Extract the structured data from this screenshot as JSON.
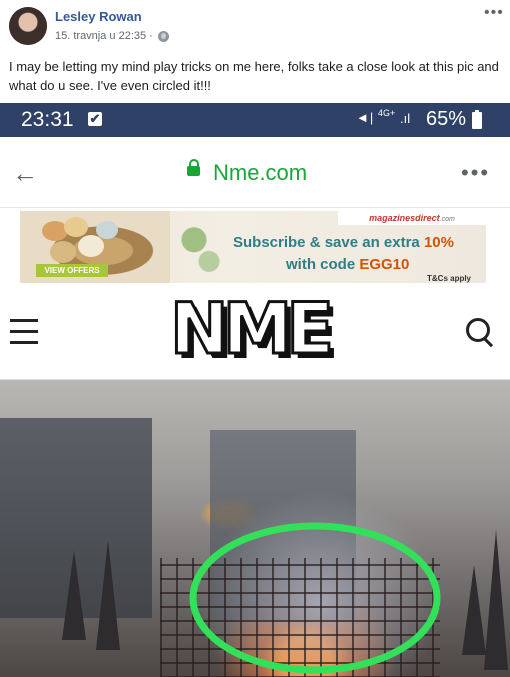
{
  "post": {
    "author": "Lesley Rowan",
    "timestamp": "15. travnja u 22:35 ·",
    "privacy_icon": "globe-icon",
    "more_label": "•••",
    "caption": "I may be letting my mind play tricks on me here, folks take a close look at this pic and what do u see. I've even circled it!!!"
  },
  "phone": {
    "status": {
      "time": "23:31",
      "notif_mark": "✔",
      "network": "4G+",
      "signal_glyph": "⁴ᴳ⁺",
      "battery": "65%"
    },
    "browser": {
      "back_glyph": "←",
      "url": "Nme.com",
      "menu_glyph": "•••"
    },
    "ad": {
      "brand": "magazinesdirect",
      "brand_suffix": ".com",
      "cta": "VIEW OFFERS",
      "line1": "Subscribe & save an extra ",
      "line1_accent": "10%",
      "line2": "with code ",
      "line2_accent": "EGG10",
      "tc": "T&Cs apply"
    },
    "site": {
      "logo": "NME"
    },
    "photo": {
      "highlight_color": "#33e05a"
    }
  },
  "colors": {
    "statusbar": "#2f4166",
    "link": "#365899",
    "secure": "#19a637"
  }
}
